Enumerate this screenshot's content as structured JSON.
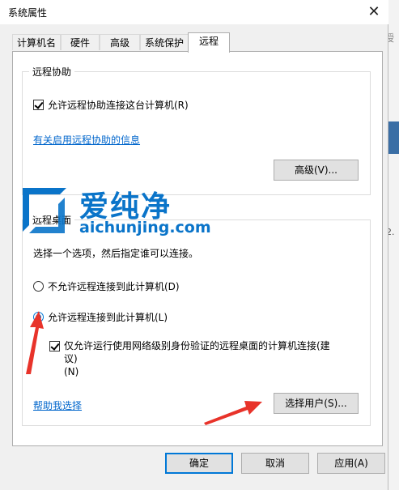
{
  "window": {
    "title": "系统属性"
  },
  "tabs": [
    {
      "label": "计算机名"
    },
    {
      "label": "硬件"
    },
    {
      "label": "高级"
    },
    {
      "label": "系统保护"
    },
    {
      "label": "远程"
    }
  ],
  "remote_assistance": {
    "group_title": "远程协助",
    "allow_checkbox_label": "允许远程协助连接这台计算机(R)",
    "allow_checked": true,
    "info_link": "有关启用远程协助的信息",
    "advanced_button": "高级(V)..."
  },
  "remote_desktop": {
    "group_title": "远程桌面",
    "instruction": "选择一个选项，然后指定谁可以连接。",
    "option_deny": "不允许远程连接到此计算机(D)",
    "option_allow": "允许远程连接到此计算机(L)",
    "nla_line1": "仅允许运行使用网络级别身份验证的远程桌面的计算机连接(建议)",
    "nla_line2": "(N)",
    "nla_checked": true,
    "help_link": "帮助我选择",
    "select_users_button": "选择用户(S)..."
  },
  "footer": {
    "ok_button": "确定",
    "cancel_button": "取消",
    "apply_button": "应用(A)"
  },
  "watermark": {
    "cn": "爱纯净",
    "en": "aichunjing.com"
  },
  "background_window": {
    "glyph": "授",
    "number": "2."
  },
  "colors": {
    "accent": "#0078d7",
    "link": "#0066cc",
    "arrow": "#e8332a",
    "watermark": "#0a74c9"
  }
}
